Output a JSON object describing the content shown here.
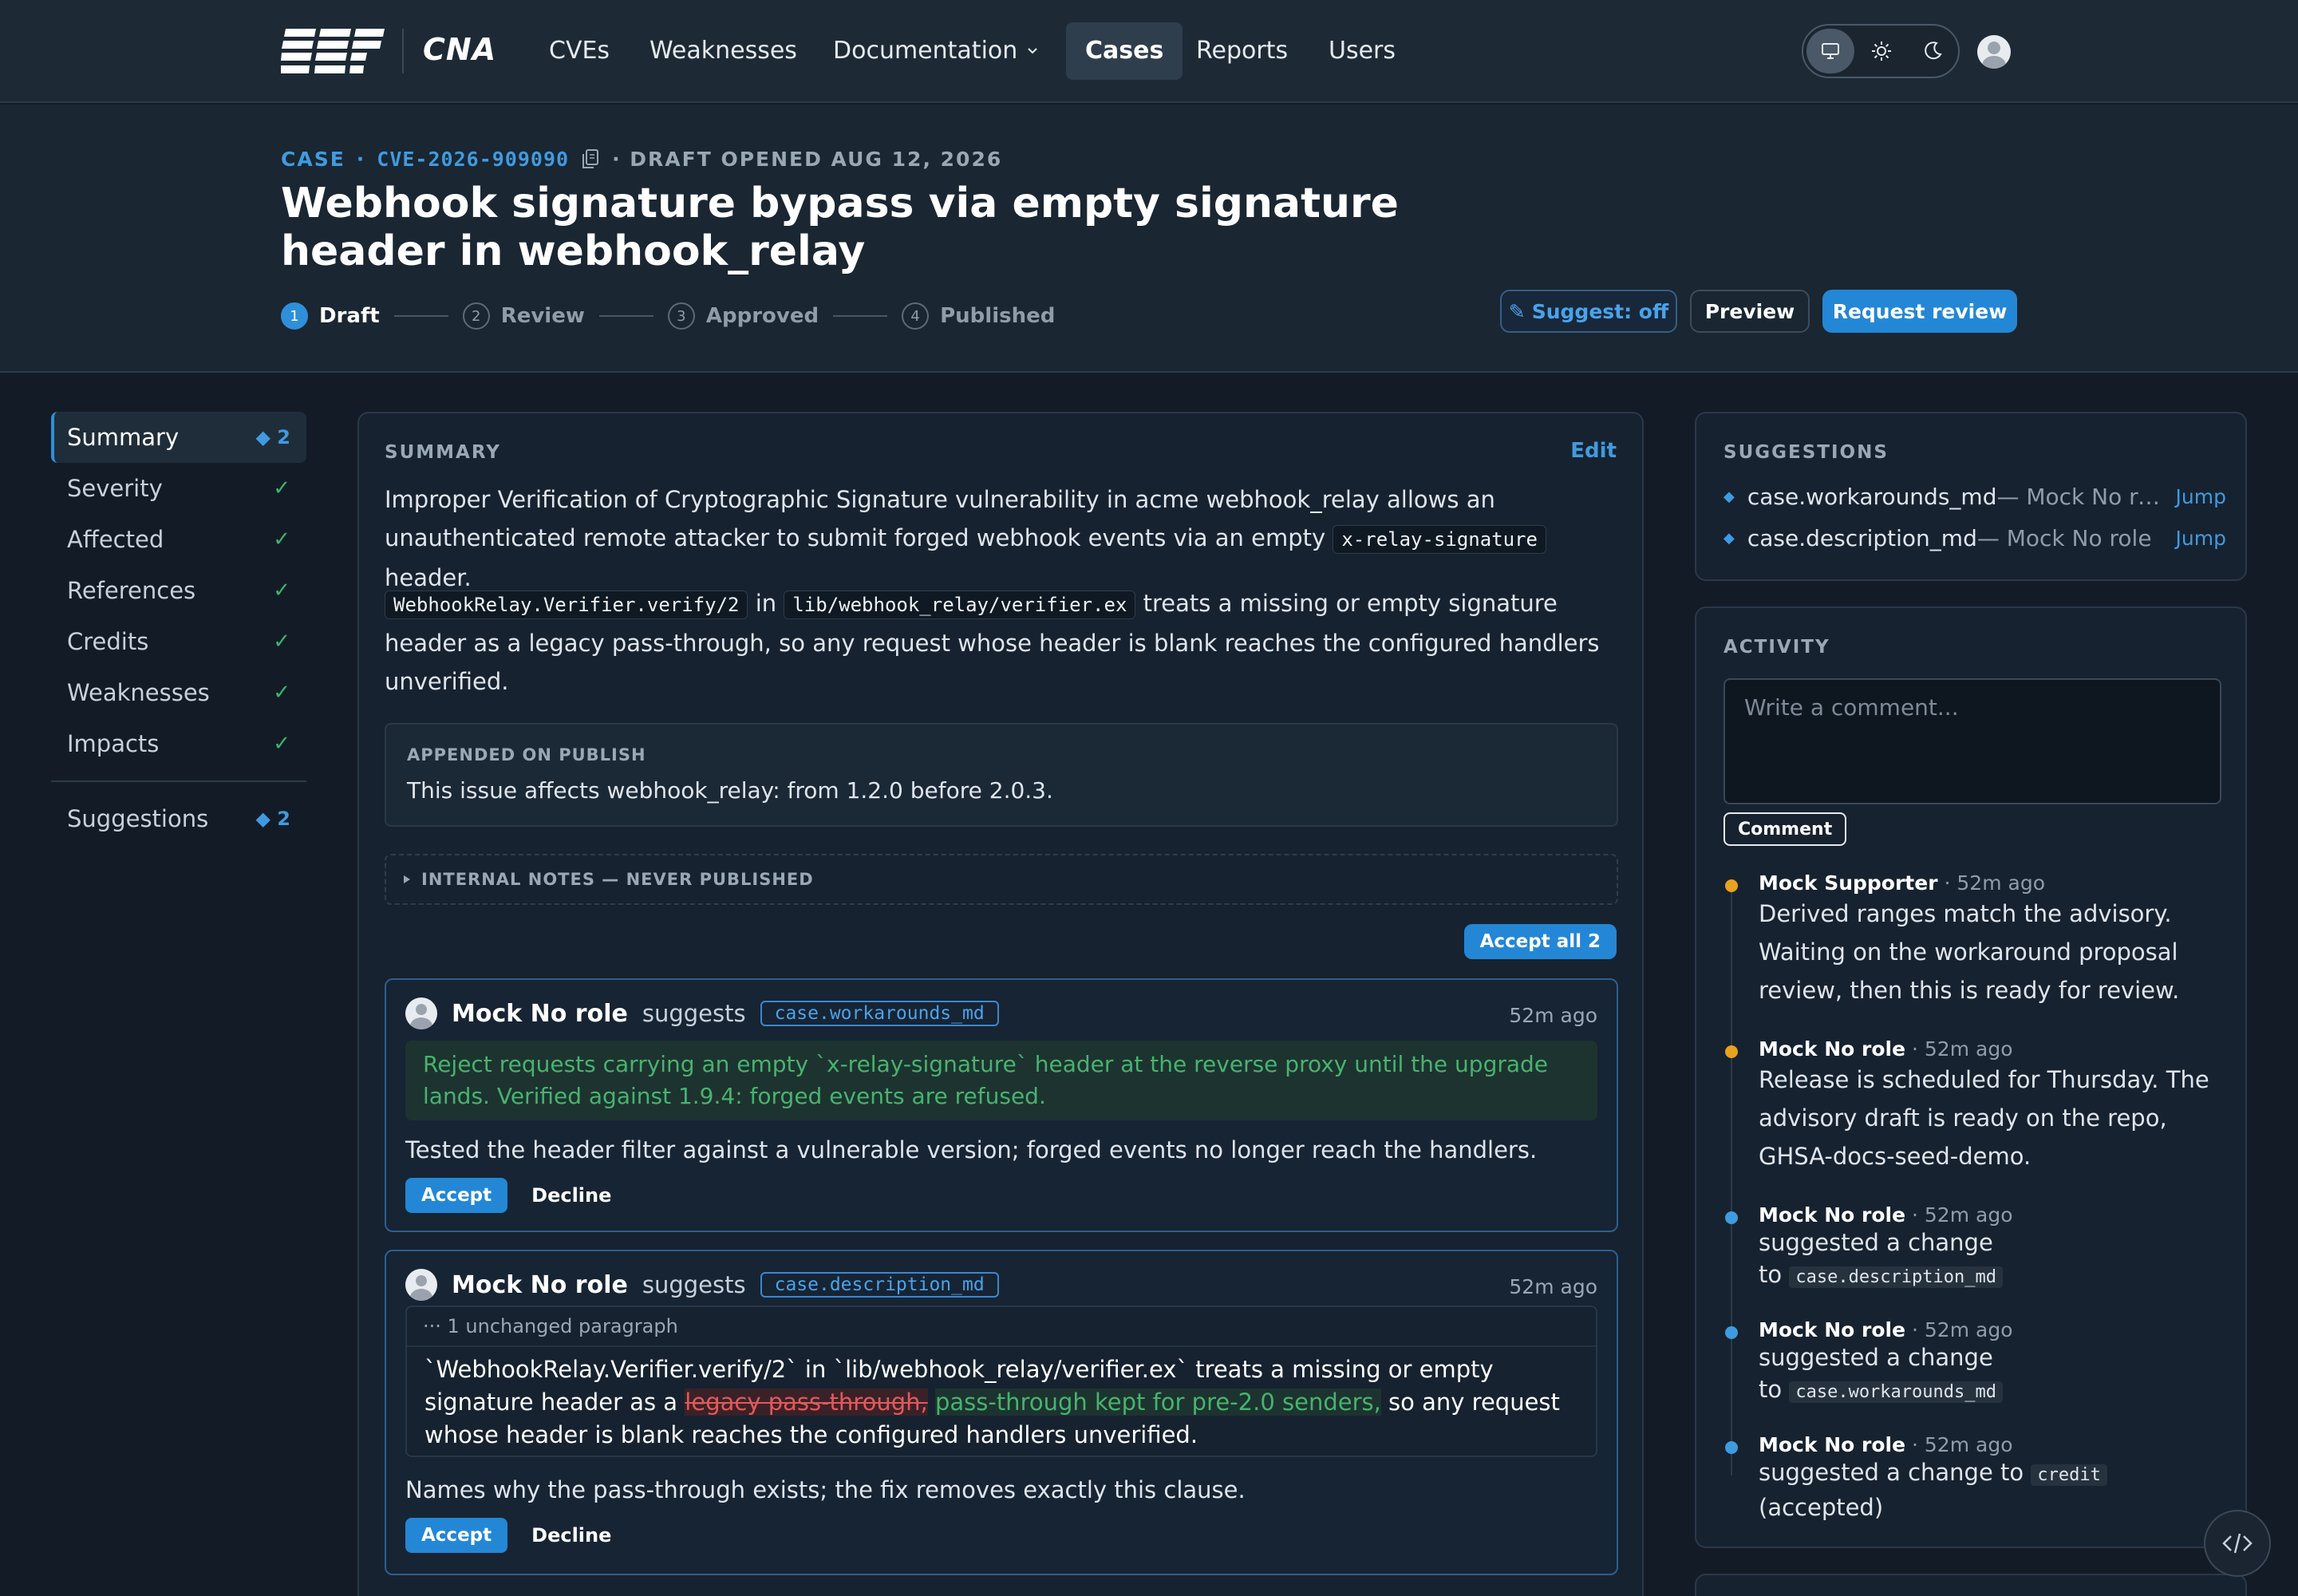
{
  "nav": {
    "brand": "CNA",
    "items": [
      "CVEs",
      "Weaknesses",
      "Documentation",
      "Cases",
      "Reports",
      "Users"
    ],
    "active": "Cases",
    "theme_modes": [
      "monitor-icon",
      "sun-icon",
      "moon-icon"
    ]
  },
  "header": {
    "crumb_case": "CASE",
    "crumb_dot": "·",
    "cve_id": "CVE-2026-909090",
    "status": "· DRAFT OPENED AUG 12, 2026",
    "title": "Webhook signature bypass via empty signature header in webhook_relay",
    "steps": [
      {
        "num": "1",
        "label": "Draft"
      },
      {
        "num": "2",
        "label": "Review"
      },
      {
        "num": "3",
        "label": "Approved"
      },
      {
        "num": "4",
        "label": "Published"
      }
    ],
    "suggest_label": "Suggest: off",
    "suggest_icon": "✎",
    "preview_label": "Preview",
    "request_review_label": "Request review"
  },
  "sidebar": {
    "items": [
      {
        "label": "Summary",
        "badge": "◆ 2"
      },
      {
        "label": "Severity",
        "check": "✓"
      },
      {
        "label": "Affected",
        "check": "✓"
      },
      {
        "label": "References",
        "check": "✓"
      },
      {
        "label": "Credits",
        "check": "✓"
      },
      {
        "label": "Weaknesses",
        "check": "✓"
      },
      {
        "label": "Impacts",
        "check": "✓"
      }
    ],
    "suggestions": {
      "label": "Suggestions",
      "badge": "◆ 2"
    }
  },
  "summary": {
    "label": "SUMMARY",
    "edit": "Edit",
    "p1_a": "Improper Verification of Cryptographic Signature vulnerability in acme webhook_relay allows an unauthenticated remote attacker to submit forged webhook events via an empty ",
    "p1_code": "x-relay-signature",
    "p1_b": " header.",
    "p2_code1": "WebhookRelay.Verifier.verify/2",
    "p2_in": " in ",
    "p2_code2": "lib/webhook_relay/verifier.ex",
    "p2_b": " treats a missing or empty signature header as a legacy pass-through, so any request whose header is blank reaches the configured handlers unverified.",
    "appended_label": "APPENDED ON PUBLISH",
    "appended_text": "This issue affects webhook_relay: from 1.2.0 before 2.0.3.",
    "internal_label": "INTERNAL NOTES — NEVER PUBLISHED",
    "accept_all": "Accept all 2"
  },
  "suggestion_cards": [
    {
      "author": "Mock No role",
      "verb": "suggests",
      "field": "case.workarounds_md",
      "time": "52m ago",
      "proposed": "Reject requests carrying an empty `x-relay-signature` header at the reverse proxy until the upgrade lands. Verified against 1.9.4: forged events are refused.",
      "note": "Tested the header filter against a vulnerable version; forged events no longer reach the handlers.",
      "accept": "Accept",
      "decline": "Decline"
    },
    {
      "author": "Mock No role",
      "verb": "suggests",
      "field": "case.description_md",
      "time": "52m ago",
      "unchanged": "··· 1 unchanged paragraph",
      "diff_a": "`WebhookRelay.Verifier.verify/2` in `lib/webhook_relay/verifier.ex` treats a missing or empty signature header as a ",
      "diff_del": "legacy pass-through,",
      "diff_ins": "pass-through kept for pre-2.0 senders,",
      "diff_b": " so any request whose header is blank reaches the configured handlers unverified.",
      "note": "Names why the pass-through exists; the fix removes exactly this clause.",
      "accept": "Accept",
      "decline": "Decline"
    }
  ],
  "suggestions_panel": {
    "label": "SUGGESTIONS",
    "items": [
      {
        "key": "case.workarounds_md",
        "rest": " — Mock No role",
        "jump": "Jump"
      },
      {
        "key": "case.description_md",
        "rest": " — Mock No role",
        "jump": "Jump"
      }
    ]
  },
  "activity": {
    "label": "ACTIVITY",
    "placeholder": "Write a comment...",
    "comment_button": "Comment",
    "entries": [
      {
        "author": "Mock Supporter",
        "time": " · 52m ago",
        "text": "Derived ranges match the advisory. Waiting on the workaround proposal review, then this is ready for review.",
        "color": "#e8a21e"
      },
      {
        "author": "Mock No role",
        "time": " · 52m ago",
        "text": "Release is scheduled for Thursday. The advisory draft is ready on the repo, GHSA-docs-seed-demo.",
        "color": "#e8a21e"
      },
      {
        "author": "Mock No role",
        "time": " · 52m ago",
        "text_a": "suggested a change",
        "text_b": "to ",
        "code": "case.description_md",
        "color": "#3f9be0"
      },
      {
        "author": "Mock No role",
        "time": " · 52m ago",
        "text_a": "suggested a change",
        "text_b": "to ",
        "code": "case.workarounds_md",
        "color": "#3f9be0"
      },
      {
        "author": "Mock No role",
        "time": " · 52m ago",
        "text_a": "suggested a change to ",
        "code": "credit",
        "text_b": "(accepted)",
        "color": "#3f9be0"
      }
    ]
  },
  "colors": {
    "accent": "#2387d6",
    "success": "#3fb36a",
    "danger": "#e05a5a"
  }
}
